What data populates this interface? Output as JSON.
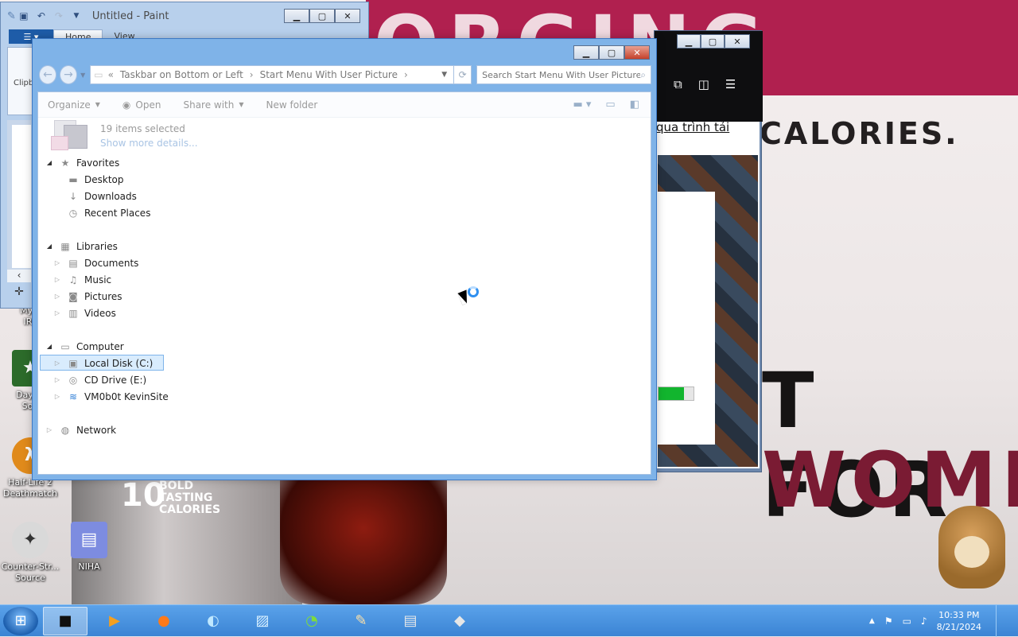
{
  "paint": {
    "title": "Untitled - Paint",
    "tabs": [
      "Home",
      "View"
    ],
    "clipboard_label": "Clipb"
  },
  "explorer": {
    "breadcrumb": [
      "Taskbar on Bottom or Left",
      "Start Menu With User Picture"
    ],
    "search_placeholder": "Search Start Menu With User Picture",
    "commands": {
      "organize": "Organize",
      "open": "Open",
      "share_with": "Share with",
      "new_folder": "New folder"
    },
    "details": {
      "count": "19 items selected",
      "more": "Show more details..."
    },
    "nav": {
      "favorites": "Favorites",
      "desktop": "Desktop",
      "downloads": "Downloads",
      "recent": "Recent Places",
      "libraries": "Libraries",
      "documents": "Documents",
      "music": "Music",
      "pictures": "Pictures",
      "videos": "Videos",
      "computer": "Computer",
      "local_disk": "Local Disk (C:)",
      "cd_drive": "CD Drive (E:)",
      "network_share": "VM0b0t KevinSite",
      "network": "Network"
    }
  },
  "browser": {
    "link_text": "qua trình tải"
  },
  "wallpaper": {
    "headline_top": "ORGING",
    "calories": "CALORIES.",
    "for": "T FOR",
    "women": "WOMEN.",
    "can_num": "10",
    "can_text": "BOLD TASTING CALORIES"
  },
  "desktop_icons": {
    "my_irl": "My F\nIRL",
    "day_of": "Day of\nSou",
    "half_life": "Half-Life 2\nDeathmatch",
    "counter_strike": "Counter-Str...\nSource",
    "niha": "NIHA"
  },
  "tray": {
    "time": "10:33 PM",
    "date": "8/21/2024"
  },
  "colors": {
    "accent": "#3b84d4",
    "selection": "#d9ecfd",
    "progress": "#12b52e"
  }
}
